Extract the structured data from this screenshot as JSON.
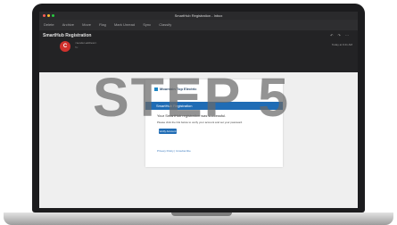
{
  "window": {
    "title": "SmartHub Registration - Inbox"
  },
  "toolbar": {
    "items": [
      "Delete",
      "Archive",
      "Move",
      "Flag",
      "Mark Unread",
      "Sync",
      "Classify"
    ]
  },
  "message": {
    "subject": "SmartHub Registration",
    "avatar_initial": "C",
    "sender": "<sender-address>",
    "sender_sub": "To: ",
    "timestamp": "Today at 9:41 AM",
    "header_icons": "↶ ↷ ⋯"
  },
  "email": {
    "brand": "Mountain Top Electric",
    "banner": "SmartHub Registration",
    "line1": "Your SmartHub registration was successful.",
    "line2": "Please click the link below to verify your account and set your password.",
    "button": "Verify Account",
    "footer_links": "Privacy Policy | Unsubscribe"
  },
  "overlay": {
    "step_text": "STEP 5"
  },
  "colors": {
    "accent": "#1f6cb5",
    "avatar": "#d0312d",
    "traffic_red": "#ff5f57",
    "traffic_yellow": "#febc2e",
    "traffic_green": "#28c840"
  }
}
